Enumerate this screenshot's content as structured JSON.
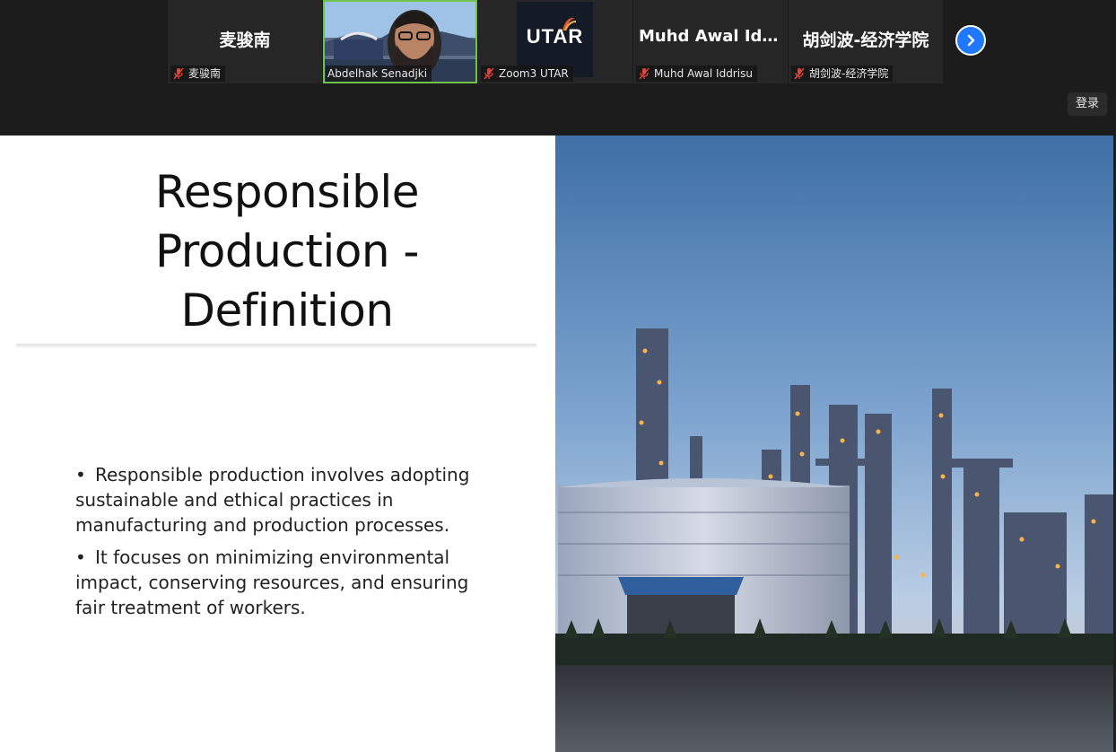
{
  "participants": [
    {
      "display_name": "麦骏南",
      "label": "麦骏南"
    },
    {
      "display_name": "",
      "label": "Abdelhak Senadjki"
    },
    {
      "display_name": "UTAR",
      "label": "Zoom3 UTAR"
    },
    {
      "display_name": "Muhd Awal Idd...",
      "label": "Muhd Awal Iddrisu"
    },
    {
      "display_name": "胡剑波-经济学院",
      "label": "胡剑波-经济学院"
    }
  ],
  "header": {
    "login_label": "登录"
  },
  "slide": {
    "title_lines": [
      "Responsible",
      "Production -",
      "Definition"
    ],
    "bullets": [
      "Responsible production involves adopting sustainable and ethical practices in manufacturing and production processes.",
      "It focuses on minimizing environmental impact, conserving resources, and ensuring fair treatment of workers."
    ],
    "bullet_symbol": "•"
  },
  "colors": {
    "active_speaker_border": "#6fc24a",
    "accent": "#1f78ff",
    "muted_icon": "#e0453a"
  },
  "icons": {
    "muted": "mic-muted-icon",
    "next": "chevron-right-icon"
  }
}
